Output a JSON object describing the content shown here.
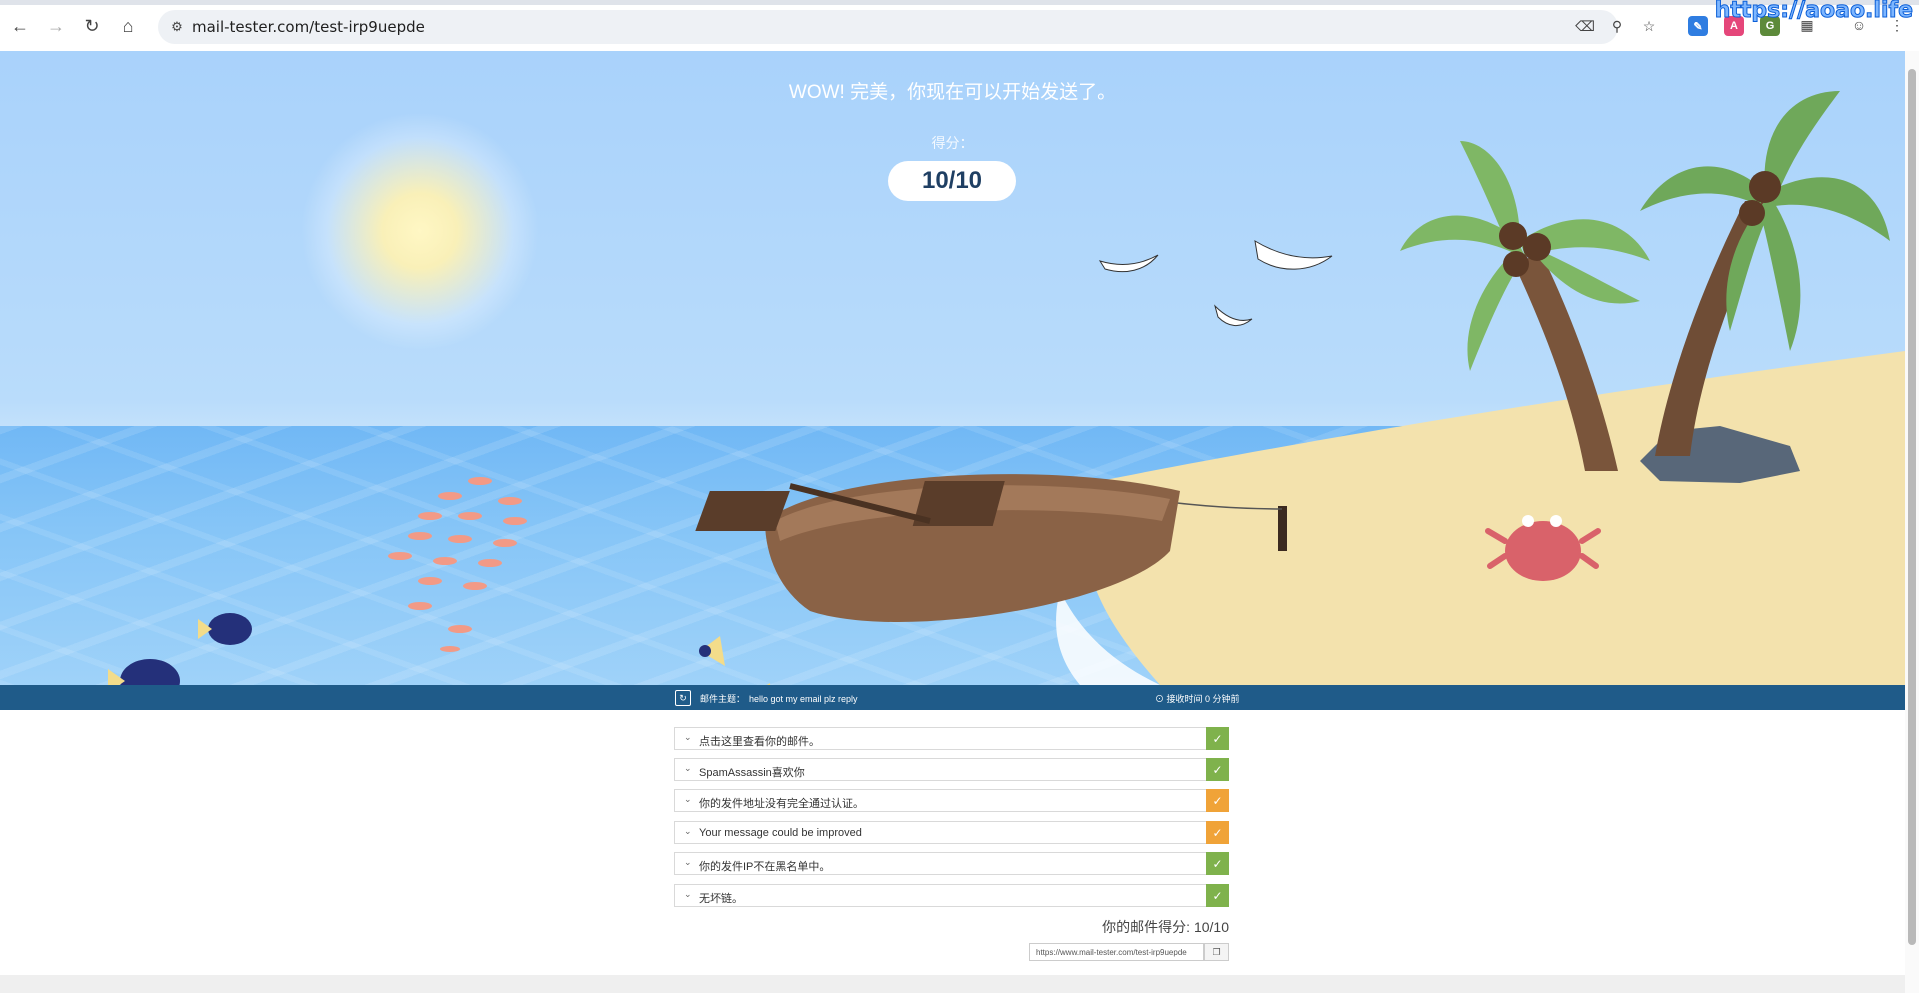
{
  "browser": {
    "url": "mail-tester.com/test-irp9uepde",
    "watermark": "https://aoao.life",
    "nav": {
      "back_icon": "arrow-left-icon",
      "forward_icon": "arrow-right-icon",
      "reload_icon": "reload-icon",
      "home_icon": "home-icon"
    },
    "extensions": [
      {
        "name": "translate-icon"
      },
      {
        "name": "zoom-icon"
      },
      {
        "name": "bookmark-star-icon"
      }
    ]
  },
  "hero": {
    "title": "WOW! 完美，你现在可以开始发送了。",
    "score_label": "得分：",
    "score": "10/10"
  },
  "infobar": {
    "refresh_icon": "refresh-icon",
    "subject_label": "邮件主题：",
    "subject": "hello got my email plz reply",
    "received": "⊙ 接收时间 0 分钟前"
  },
  "checks": [
    {
      "label": "点击这里查看你的邮件。",
      "status": "pass",
      "color": "#7fb24c"
    },
    {
      "label": "SpamAssassin喜欢你",
      "status": "pass",
      "color": "#7fb24c"
    },
    {
      "label": "你的发件地址没有完全通过认证。",
      "status": "warn",
      "color": "#f0a338"
    },
    {
      "label": "Your message could be improved",
      "status": "warn",
      "color": "#f0a338"
    },
    {
      "label": "你的发件IP不在黑名单中。",
      "status": "pass",
      "color": "#7fb24c"
    },
    {
      "label": "无坏链。",
      "status": "pass",
      "color": "#7fb24c"
    }
  ],
  "summary": {
    "total_label": "你的邮件得分: 10/10",
    "share_url": "https://www.mail-tester.com/test-irp9uepde",
    "copy_icon": "copy-icon"
  }
}
